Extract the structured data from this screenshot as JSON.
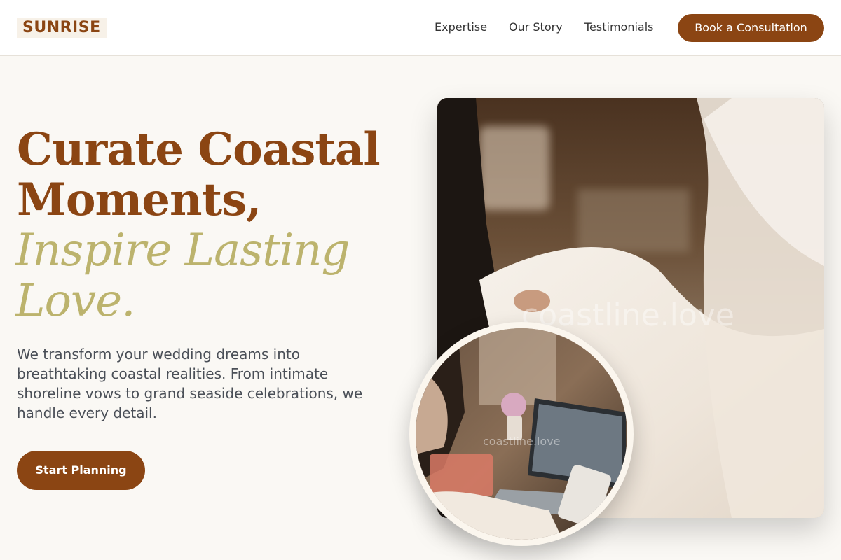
{
  "header": {
    "logo": "SUNRISE",
    "nav": [
      "Expertise",
      "Our Story",
      "Testimonials"
    ],
    "cta_label": "Book a Consultation"
  },
  "hero": {
    "title_lines": [
      "Curate Coastal",
      "Moments,"
    ],
    "accent_lines": [
      "Inspire Lasting",
      "Love."
    ],
    "description": "We transform your wedding dreams into breathtaking coastal realities. From intimate shoreline vows to grand seaside celebrations, we handle every detail.",
    "cta_label": "Start Planning"
  },
  "images": {
    "main_watermark": "coastline.love",
    "circle_watermark": "coastline.love"
  },
  "colors": {
    "brand": "#8b4513",
    "accent": "#bcb36d",
    "background": "#faf8f4"
  }
}
